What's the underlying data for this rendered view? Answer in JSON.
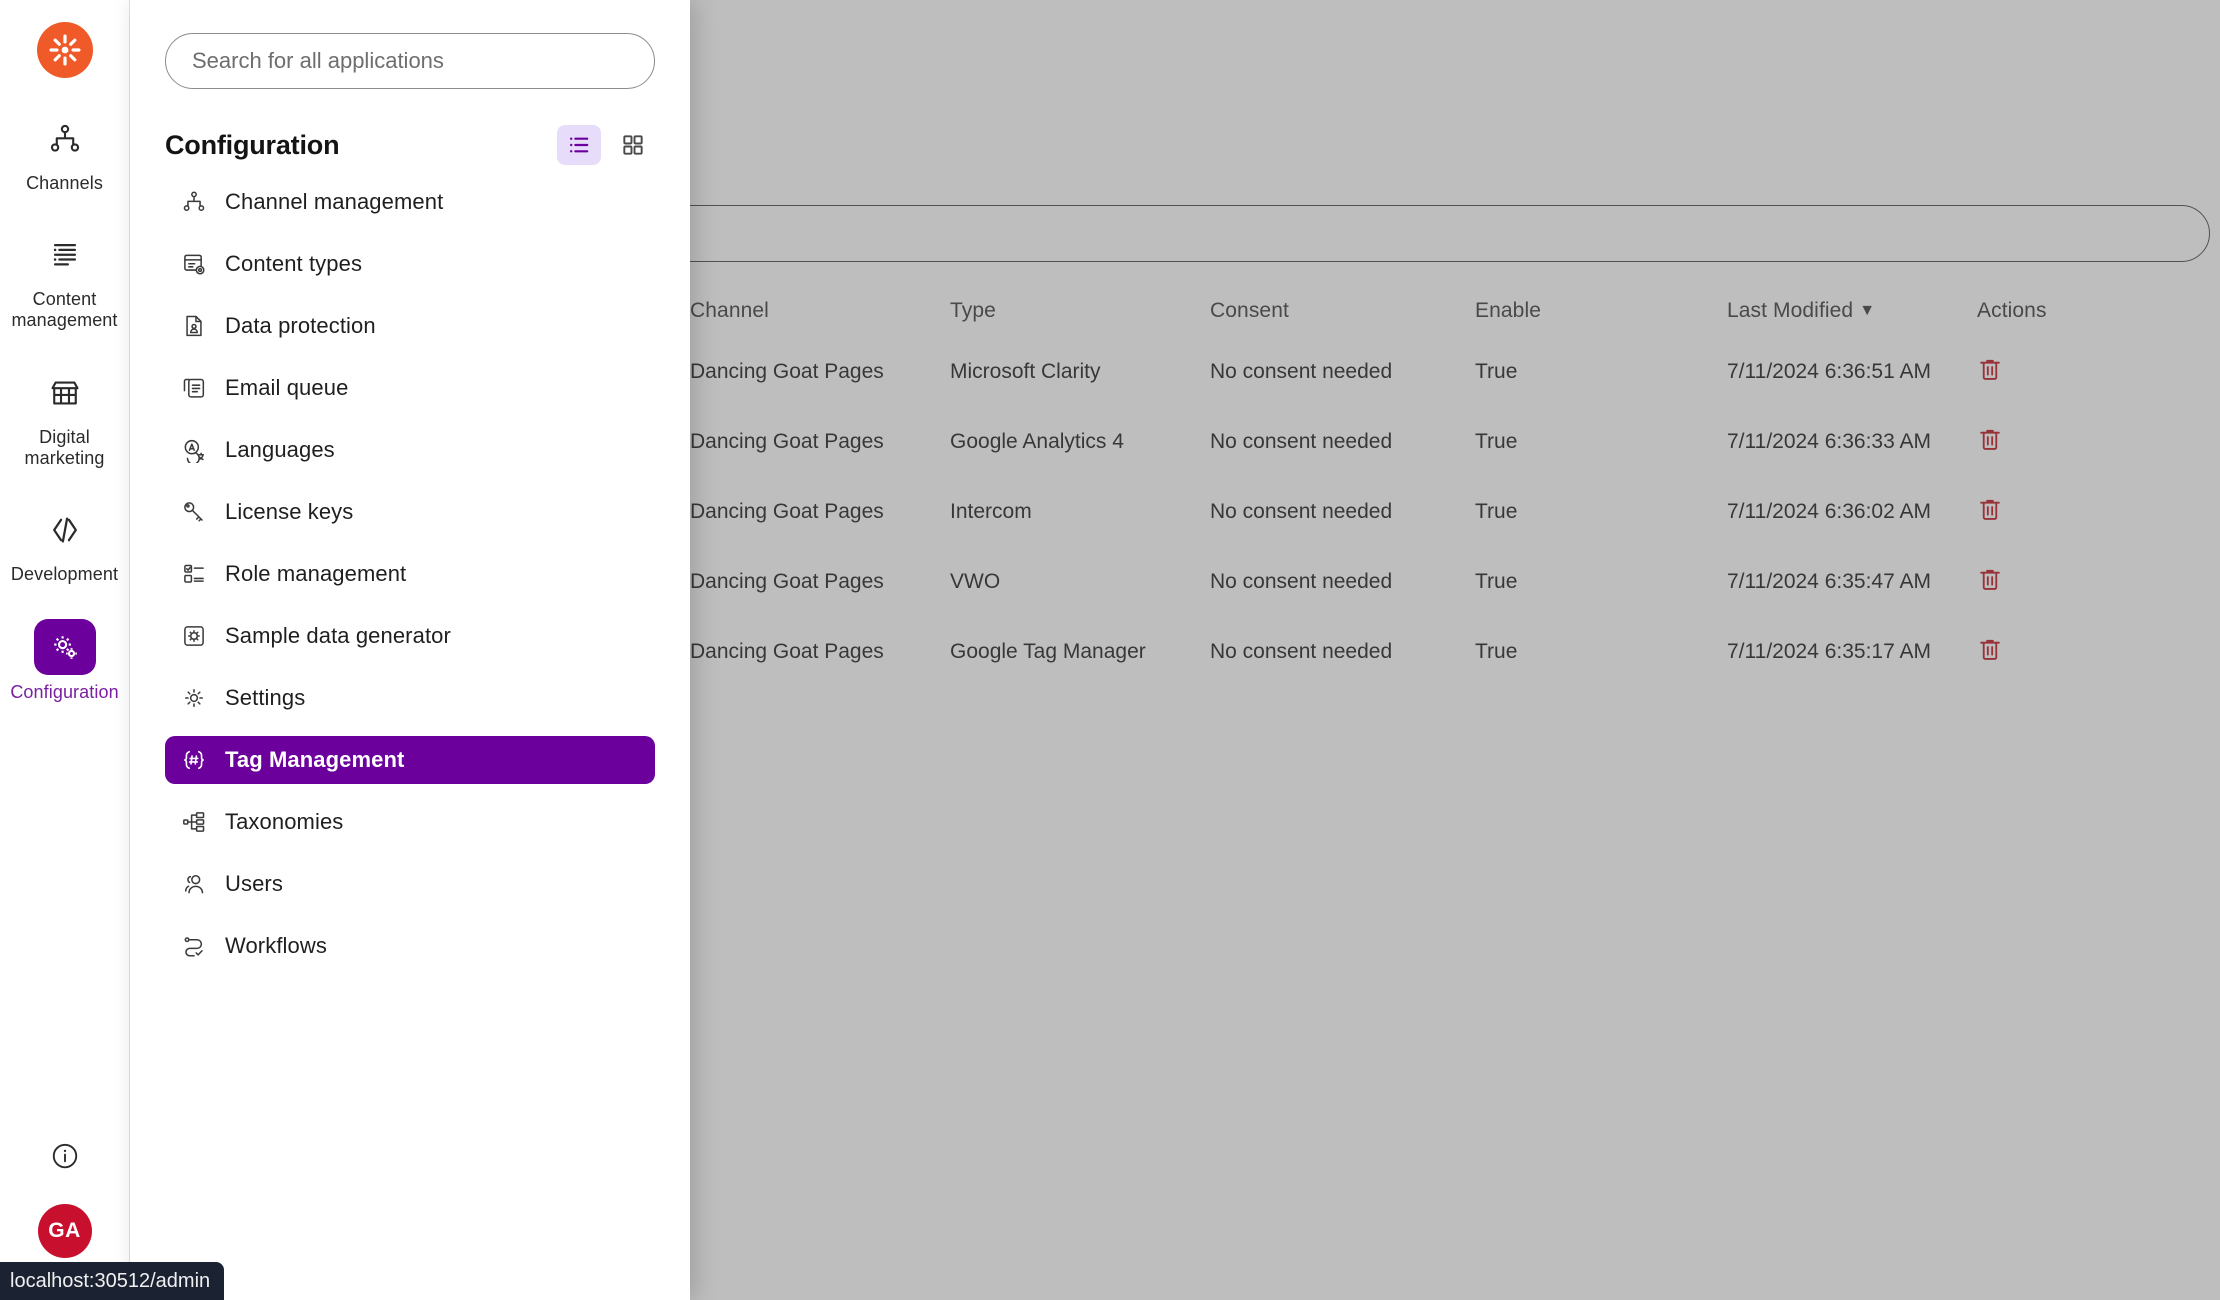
{
  "rail": {
    "logo_icon": "kentico-asterisk-logo",
    "items": [
      {
        "label": "Channels",
        "icon": "channels-network-icon",
        "active": false
      },
      {
        "label": "Content\nmanagement",
        "label_line1": "Content",
        "label_line2": "management",
        "icon": "content-list-icon",
        "active": false
      },
      {
        "label": "Digital\nmarketing",
        "label_line1": "Digital",
        "label_line2": "marketing",
        "icon": "storefront-icon",
        "active": false
      },
      {
        "label": "Development",
        "label_line1": "Development",
        "label_line2": "",
        "icon": "code-brackets-icon",
        "active": false
      },
      {
        "label": "Configuration",
        "label_line1": "Configuration",
        "label_line2": "",
        "icon": "gears-icon",
        "active": true
      }
    ],
    "info_icon": "info-circle-icon",
    "avatar_initials": "GA"
  },
  "flyout": {
    "search": {
      "placeholder": "Search for all applications",
      "value": ""
    },
    "title": "Configuration",
    "view_toggle": {
      "list_icon": "list-view-icon",
      "grid_icon": "grid-view-icon",
      "active": "list"
    },
    "items": [
      {
        "label": "Channel management",
        "icon": "channels-network-icon",
        "selected": false
      },
      {
        "label": "Content types",
        "icon": "content-type-icon",
        "selected": false
      },
      {
        "label": "Data protection",
        "icon": "data-protection-icon",
        "selected": false
      },
      {
        "label": "Email queue",
        "icon": "email-queue-icon",
        "selected": false
      },
      {
        "label": "Languages",
        "icon": "languages-icon",
        "selected": false
      },
      {
        "label": "License keys",
        "icon": "key-icon",
        "selected": false
      },
      {
        "label": "Role management",
        "icon": "role-management-icon",
        "selected": false
      },
      {
        "label": "Sample data generator",
        "icon": "sample-data-icon",
        "selected": false
      },
      {
        "label": "Settings",
        "icon": "gear-icon",
        "selected": false
      },
      {
        "label": "Tag Management",
        "icon": "tag-hash-icon",
        "selected": true
      },
      {
        "label": "Taxonomies",
        "icon": "taxonomies-icon",
        "selected": false
      },
      {
        "label": "Users",
        "icon": "users-icon",
        "selected": false
      },
      {
        "label": "Workflows",
        "icon": "workflows-icon",
        "selected": false
      }
    ]
  },
  "background": {
    "search": {
      "placeholder": "",
      "value": ""
    },
    "table": {
      "columns": [
        "Channel",
        "Type",
        "Consent",
        "Enable",
        "Last Modified",
        "Actions"
      ],
      "sorted_column": "Last Modified",
      "sort_direction": "desc",
      "sort_caret": "▼",
      "rows": [
        {
          "channel": "Dancing Goat Pages",
          "type": "Microsoft Clarity",
          "consent": "No consent needed",
          "enable": "True",
          "last_modified": "7/11/2024 6:36:51 AM",
          "action_icon": "delete-trash-icon"
        },
        {
          "channel": "Dancing Goat Pages",
          "type": "Google Analytics 4",
          "consent": "No consent needed",
          "enable": "True",
          "last_modified": "7/11/2024 6:36:33 AM",
          "action_icon": "delete-trash-icon"
        },
        {
          "channel": "Dancing Goat Pages",
          "type": "Intercom",
          "consent": "No consent needed",
          "enable": "True",
          "last_modified": "7/11/2024 6:36:02 AM",
          "action_icon": "delete-trash-icon"
        },
        {
          "channel": "Dancing Goat Pages",
          "type": "VWO",
          "consent": "No consent needed",
          "enable": "True",
          "last_modified": "7/11/2024 6:35:47 AM",
          "action_icon": "delete-trash-icon"
        },
        {
          "channel": "Dancing Goat Pages",
          "type": "Google Tag Manager",
          "consent": "No consent needed",
          "enable": "True",
          "last_modified": "7/11/2024 6:35:17 AM",
          "action_icon": "delete-trash-icon"
        }
      ]
    }
  },
  "status_bar": {
    "text": "localhost:30512/admin"
  },
  "colors": {
    "brand_orange": "#f05a28",
    "accent_purple": "#6b009c",
    "accent_purple_light": "#e7ddfb",
    "avatar_red": "#c8102e",
    "delete_red": "#c01722",
    "status_bar_bg": "#1b2232"
  }
}
